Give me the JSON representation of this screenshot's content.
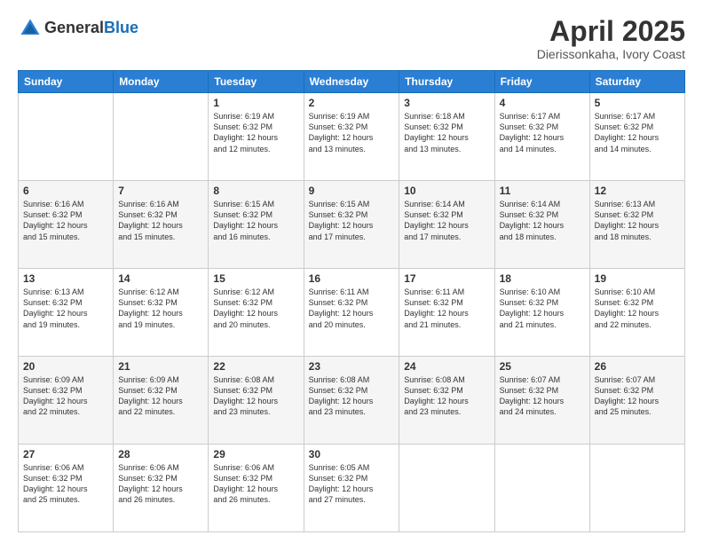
{
  "header": {
    "logo_line1": "General",
    "logo_line2": "Blue",
    "month": "April 2025",
    "location": "Dierissonkaha, Ivory Coast"
  },
  "weekdays": [
    "Sunday",
    "Monday",
    "Tuesday",
    "Wednesday",
    "Thursday",
    "Friday",
    "Saturday"
  ],
  "weeks": [
    [
      {
        "day": "",
        "info": ""
      },
      {
        "day": "",
        "info": ""
      },
      {
        "day": "1",
        "info": "Sunrise: 6:19 AM\nSunset: 6:32 PM\nDaylight: 12 hours\nand 12 minutes."
      },
      {
        "day": "2",
        "info": "Sunrise: 6:19 AM\nSunset: 6:32 PM\nDaylight: 12 hours\nand 13 minutes."
      },
      {
        "day": "3",
        "info": "Sunrise: 6:18 AM\nSunset: 6:32 PM\nDaylight: 12 hours\nand 13 minutes."
      },
      {
        "day": "4",
        "info": "Sunrise: 6:17 AM\nSunset: 6:32 PM\nDaylight: 12 hours\nand 14 minutes."
      },
      {
        "day": "5",
        "info": "Sunrise: 6:17 AM\nSunset: 6:32 PM\nDaylight: 12 hours\nand 14 minutes."
      }
    ],
    [
      {
        "day": "6",
        "info": "Sunrise: 6:16 AM\nSunset: 6:32 PM\nDaylight: 12 hours\nand 15 minutes."
      },
      {
        "day": "7",
        "info": "Sunrise: 6:16 AM\nSunset: 6:32 PM\nDaylight: 12 hours\nand 15 minutes."
      },
      {
        "day": "8",
        "info": "Sunrise: 6:15 AM\nSunset: 6:32 PM\nDaylight: 12 hours\nand 16 minutes."
      },
      {
        "day": "9",
        "info": "Sunrise: 6:15 AM\nSunset: 6:32 PM\nDaylight: 12 hours\nand 17 minutes."
      },
      {
        "day": "10",
        "info": "Sunrise: 6:14 AM\nSunset: 6:32 PM\nDaylight: 12 hours\nand 17 minutes."
      },
      {
        "day": "11",
        "info": "Sunrise: 6:14 AM\nSunset: 6:32 PM\nDaylight: 12 hours\nand 18 minutes."
      },
      {
        "day": "12",
        "info": "Sunrise: 6:13 AM\nSunset: 6:32 PM\nDaylight: 12 hours\nand 18 minutes."
      }
    ],
    [
      {
        "day": "13",
        "info": "Sunrise: 6:13 AM\nSunset: 6:32 PM\nDaylight: 12 hours\nand 19 minutes."
      },
      {
        "day": "14",
        "info": "Sunrise: 6:12 AM\nSunset: 6:32 PM\nDaylight: 12 hours\nand 19 minutes."
      },
      {
        "day": "15",
        "info": "Sunrise: 6:12 AM\nSunset: 6:32 PM\nDaylight: 12 hours\nand 20 minutes."
      },
      {
        "day": "16",
        "info": "Sunrise: 6:11 AM\nSunset: 6:32 PM\nDaylight: 12 hours\nand 20 minutes."
      },
      {
        "day": "17",
        "info": "Sunrise: 6:11 AM\nSunset: 6:32 PM\nDaylight: 12 hours\nand 21 minutes."
      },
      {
        "day": "18",
        "info": "Sunrise: 6:10 AM\nSunset: 6:32 PM\nDaylight: 12 hours\nand 21 minutes."
      },
      {
        "day": "19",
        "info": "Sunrise: 6:10 AM\nSunset: 6:32 PM\nDaylight: 12 hours\nand 22 minutes."
      }
    ],
    [
      {
        "day": "20",
        "info": "Sunrise: 6:09 AM\nSunset: 6:32 PM\nDaylight: 12 hours\nand 22 minutes."
      },
      {
        "day": "21",
        "info": "Sunrise: 6:09 AM\nSunset: 6:32 PM\nDaylight: 12 hours\nand 22 minutes."
      },
      {
        "day": "22",
        "info": "Sunrise: 6:08 AM\nSunset: 6:32 PM\nDaylight: 12 hours\nand 23 minutes."
      },
      {
        "day": "23",
        "info": "Sunrise: 6:08 AM\nSunset: 6:32 PM\nDaylight: 12 hours\nand 23 minutes."
      },
      {
        "day": "24",
        "info": "Sunrise: 6:08 AM\nSunset: 6:32 PM\nDaylight: 12 hours\nand 23 minutes."
      },
      {
        "day": "25",
        "info": "Sunrise: 6:07 AM\nSunset: 6:32 PM\nDaylight: 12 hours\nand 24 minutes."
      },
      {
        "day": "26",
        "info": "Sunrise: 6:07 AM\nSunset: 6:32 PM\nDaylight: 12 hours\nand 25 minutes."
      }
    ],
    [
      {
        "day": "27",
        "info": "Sunrise: 6:06 AM\nSunset: 6:32 PM\nDaylight: 12 hours\nand 25 minutes."
      },
      {
        "day": "28",
        "info": "Sunrise: 6:06 AM\nSunset: 6:32 PM\nDaylight: 12 hours\nand 26 minutes."
      },
      {
        "day": "29",
        "info": "Sunrise: 6:06 AM\nSunset: 6:32 PM\nDaylight: 12 hours\nand 26 minutes."
      },
      {
        "day": "30",
        "info": "Sunrise: 6:05 AM\nSunset: 6:32 PM\nDaylight: 12 hours\nand 27 minutes."
      },
      {
        "day": "",
        "info": ""
      },
      {
        "day": "",
        "info": ""
      },
      {
        "day": "",
        "info": ""
      }
    ]
  ]
}
